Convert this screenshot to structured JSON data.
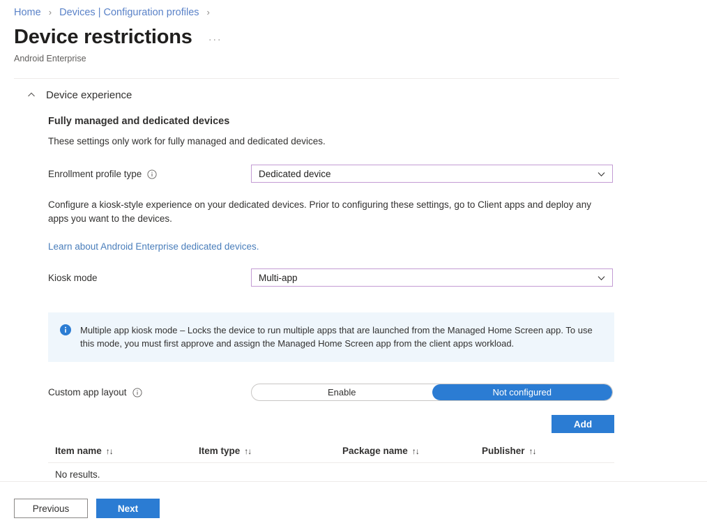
{
  "breadcrumb": {
    "items": [
      {
        "label": "Home"
      },
      {
        "label": "Devices | Configuration profiles"
      }
    ],
    "separator": "›"
  },
  "header": {
    "title": "Device restrictions",
    "ellipsis": "···",
    "subtitle": "Android Enterprise"
  },
  "section": {
    "title": "Device experience",
    "collapse_icon": "chevron-up-icon"
  },
  "group": {
    "title": "Fully managed and dedicated devices",
    "description": "These settings only work for fully managed and dedicated devices."
  },
  "fields": {
    "enrollment_profile_type": {
      "label": "Enrollment profile type",
      "info_icon": "info-icon",
      "value": "Dedicated device",
      "chevron_icon": "chevron-down-icon",
      "border_color": "#c39bd3"
    },
    "kiosk_mode": {
      "label": "Kiosk mode",
      "value": "Multi-app",
      "chevron_icon": "chevron-down-icon",
      "border_color": "#c39bd3"
    },
    "custom_app_layout": {
      "label": "Custom app layout",
      "info_icon": "info-icon",
      "options": [
        {
          "label": "Enable",
          "selected": false
        },
        {
          "label": "Not configured",
          "selected": true
        }
      ],
      "selected_color": "#2b7cd3"
    }
  },
  "paragraph": {
    "text": "Configure a kiosk-style experience on your dedicated devices. Prior to configuring these settings, go to Client apps and deploy any apps you want to the devices.",
    "link_text": "Learn about Android Enterprise dedicated devices.",
    "link_color": "#4a7ebb"
  },
  "info_banner": {
    "icon": "info-circle-icon",
    "text": "Multiple app kiosk mode – Locks the device to run multiple apps that are launched from the Managed Home Screen app. To use this mode, you must first approve and assign the Managed Home Screen app from the client apps workload.",
    "background_color": "#eff6fc",
    "icon_color": "#2b7cd3"
  },
  "table": {
    "add_label": "Add",
    "sort_arrows": "↑↓",
    "columns": [
      {
        "label": "Item name"
      },
      {
        "label": "Item type"
      },
      {
        "label": "Package name"
      },
      {
        "label": "Publisher"
      }
    ],
    "empty_text": "No results."
  },
  "footer": {
    "previous_label": "Previous",
    "next_label": "Next",
    "next_color": "#2b7cd3"
  }
}
